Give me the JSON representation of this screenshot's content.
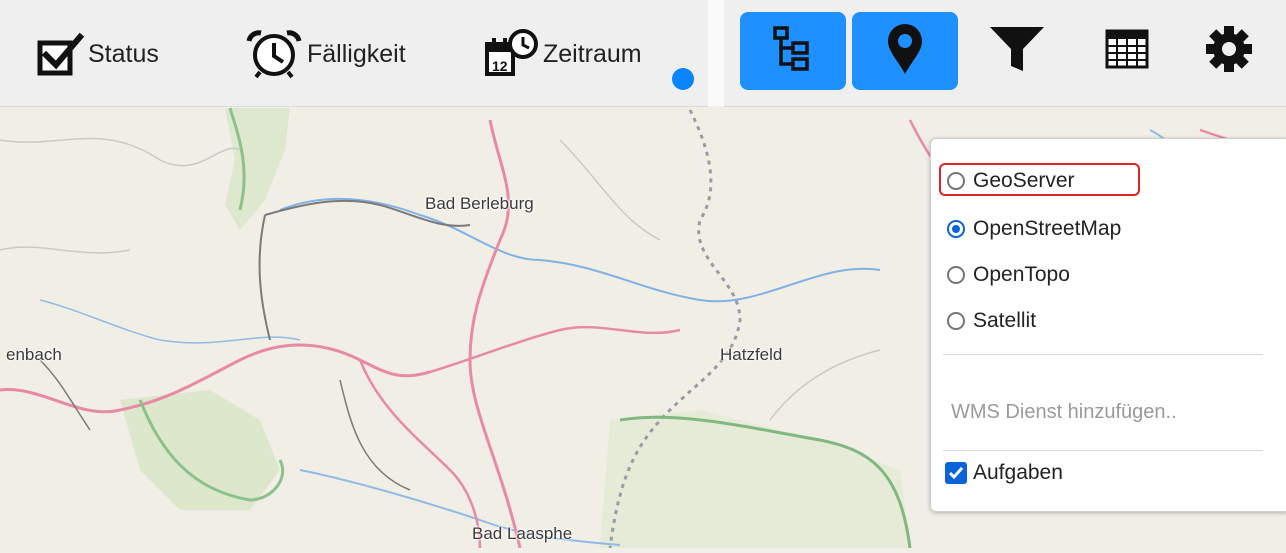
{
  "toolbar_left": {
    "status_label": "Status",
    "faelligkeit_label": "Fälligkeit",
    "zeitraum_label": "Zeitraum"
  },
  "toolbar_right": {
    "icons": [
      "hierarchy-icon",
      "map-pin-icon",
      "filter-icon",
      "table-icon",
      "gear-icon"
    ],
    "accent": "#1e90ff"
  },
  "map": {
    "places": [
      "Bad Berleburg",
      "enbach",
      "Hatzfeld",
      "Bad Laasphe"
    ]
  },
  "layer_panel": {
    "layers": [
      {
        "label": "GeoServer",
        "selected": false
      },
      {
        "label": "OpenStreetMap",
        "selected": true
      },
      {
        "label": "OpenTopo",
        "selected": false
      },
      {
        "label": "Satellit",
        "selected": false
      }
    ],
    "wms_placeholder": "WMS Dienst hinzufügen..",
    "overlay_label": "Aufgaben",
    "overlay_checked": true,
    "highlight_color": "#e02424"
  }
}
